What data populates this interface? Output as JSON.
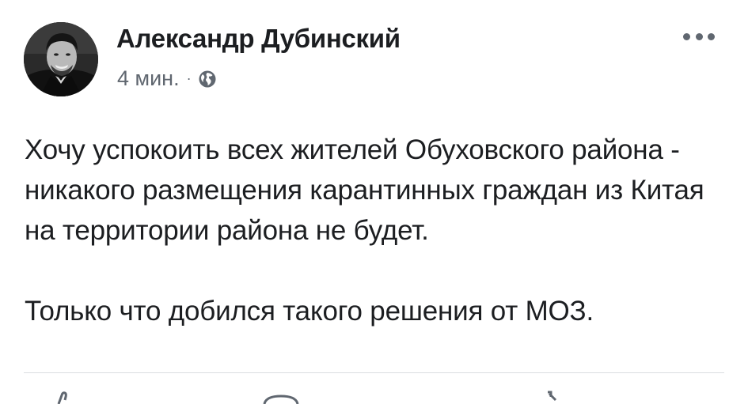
{
  "post": {
    "author": "Александр Дубинский",
    "time": "4 мин.",
    "separator": "·",
    "privacy_icon": "globe-icon",
    "menu_icon": "more-options-icon",
    "paragraphs": [
      "Хочу успокоить всех жителей Обуховского района - никакого размещения карантинных граждан из Китая на территории района не будет.",
      "Только что добился такого решения от МОЗ."
    ]
  },
  "actions": [
    {
      "icon": "like-icon"
    },
    {
      "icon": "comment-icon"
    },
    {
      "icon": "share-icon"
    }
  ],
  "colors": {
    "text": "#1c1e21",
    "meta": "#606770",
    "divider": "#dadde1"
  }
}
